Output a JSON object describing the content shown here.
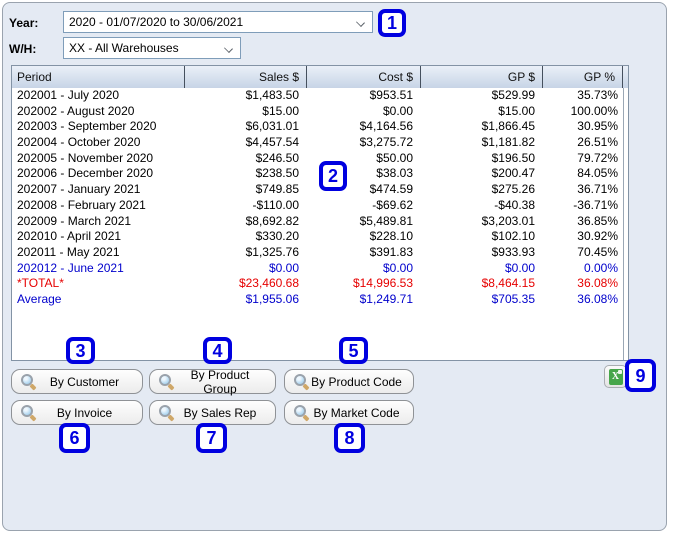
{
  "filters": {
    "year_label": "Year:",
    "year_value": "2020 - 01/07/2020 to 30/06/2021",
    "warehouse_label": "W/H:",
    "warehouse_value": "XX - All Warehouses"
  },
  "table": {
    "columns": [
      "Period",
      "Sales $",
      "Cost $",
      "GP $",
      "GP %"
    ],
    "rows": [
      {
        "period": "202001 - July 2020",
        "sales": "$1,483.50",
        "cost": "$953.51",
        "gp": "$529.99",
        "gp_pct": "35.73%",
        "style": "normal"
      },
      {
        "period": "202002 - August 2020",
        "sales": "$15.00",
        "cost": "$0.00",
        "gp": "$15.00",
        "gp_pct": "100.00%",
        "style": "normal"
      },
      {
        "period": "202003 - September 2020",
        "sales": "$6,031.01",
        "cost": "$4,164.56",
        "gp": "$1,866.45",
        "gp_pct": "30.95%",
        "style": "normal"
      },
      {
        "period": "202004 - October 2020",
        "sales": "$4,457.54",
        "cost": "$3,275.72",
        "gp": "$1,181.82",
        "gp_pct": "26.51%",
        "style": "normal"
      },
      {
        "period": "202005 - November 2020",
        "sales": "$246.50",
        "cost": "$50.00",
        "gp": "$196.50",
        "gp_pct": "79.72%",
        "style": "normal"
      },
      {
        "period": "202006 - December 2020",
        "sales": "$238.50",
        "cost": "$38.03",
        "gp": "$200.47",
        "gp_pct": "84.05%",
        "style": "normal"
      },
      {
        "period": "202007 - January 2021",
        "sales": "$749.85",
        "cost": "$474.59",
        "gp": "$275.26",
        "gp_pct": "36.71%",
        "style": "normal"
      },
      {
        "period": "202008 - February 2021",
        "sales": "-$110.00",
        "cost": "-$69.62",
        "gp": "-$40.38",
        "gp_pct": "-36.71%",
        "style": "normal"
      },
      {
        "period": "202009 - March 2021",
        "sales": "$8,692.82",
        "cost": "$5,489.81",
        "gp": "$3,203.01",
        "gp_pct": "36.85%",
        "style": "normal"
      },
      {
        "period": "202010 - April 2021",
        "sales": "$330.20",
        "cost": "$228.10",
        "gp": "$102.10",
        "gp_pct": "30.92%",
        "style": "normal"
      },
      {
        "period": "202011 - May 2021",
        "sales": "$1,325.76",
        "cost": "$391.83",
        "gp": "$933.93",
        "gp_pct": "70.45%",
        "style": "normal"
      },
      {
        "period": "202012 - June 2021",
        "sales": "$0.00",
        "cost": "$0.00",
        "gp": "$0.00",
        "gp_pct": "0.00%",
        "style": "blue"
      },
      {
        "period": "*TOTAL*",
        "sales": "$23,460.68",
        "cost": "$14,996.53",
        "gp": "$8,464.15",
        "gp_pct": "36.08%",
        "style": "red"
      },
      {
        "period": "Average",
        "sales": "$1,955.06",
        "cost": "$1,249.71",
        "gp": "$705.35",
        "gp_pct": "36.08%",
        "style": "blue"
      }
    ]
  },
  "buttons": [
    {
      "label": "By Customer"
    },
    {
      "label": "By Product Group"
    },
    {
      "label": "By Product Code"
    },
    {
      "label": "By Invoice"
    },
    {
      "label": "By Sales Rep"
    },
    {
      "label": "By Market Code"
    }
  ],
  "export_button": {
    "icon": "excel-export-icon",
    "glyph": "X"
  },
  "callouts": [
    "1",
    "2",
    "3",
    "4",
    "5",
    "6",
    "7",
    "8",
    "9"
  ],
  "colors": {
    "annotation_blue": "#0000e0",
    "row_highlight_blue": "#0000cc",
    "total_red": "#e60000",
    "panel_bg": "#e4eaf3",
    "header_gradient_top": "#eaf0f8",
    "header_gradient_bottom": "#c7d4e6",
    "dropdown_border": "#7f9db9",
    "excel_green": "#46a64a"
  }
}
